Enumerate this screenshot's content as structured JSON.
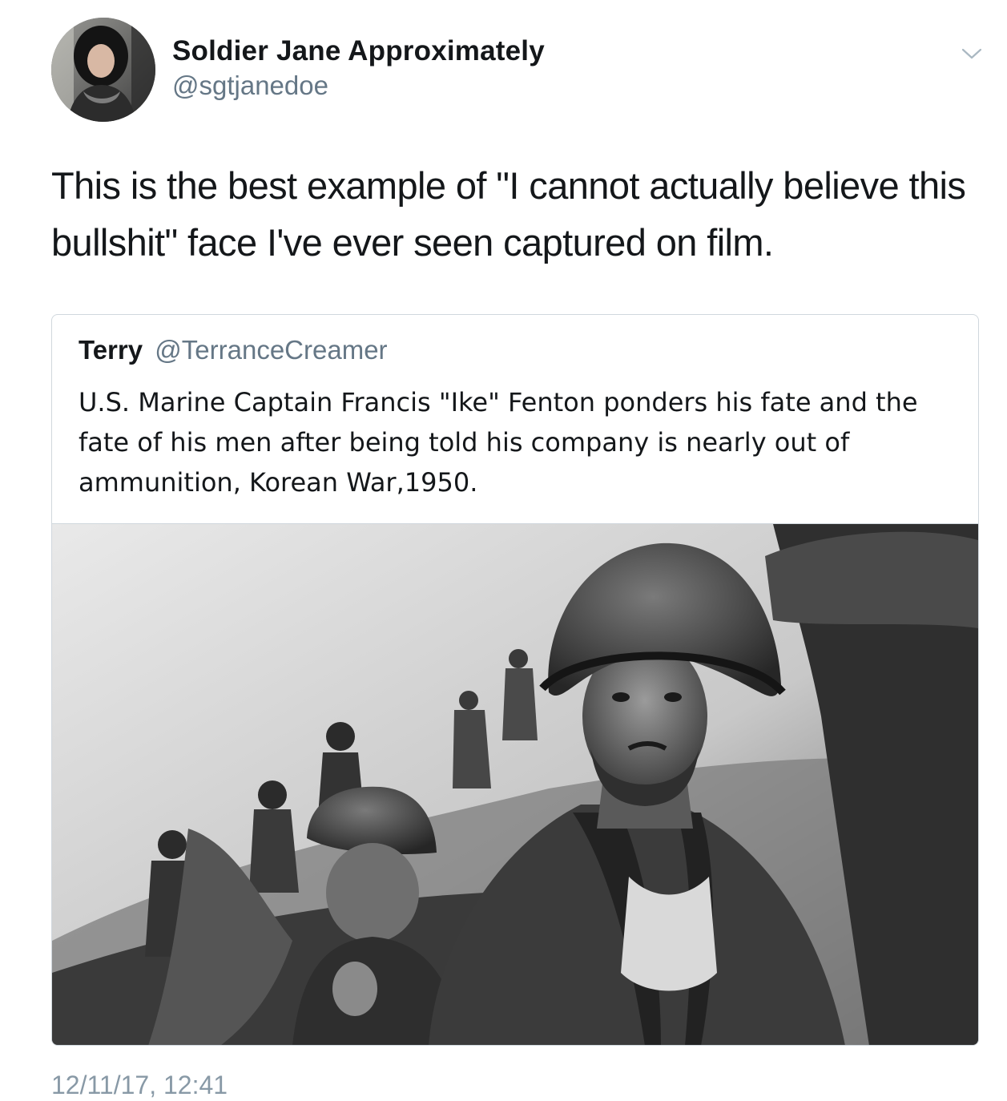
{
  "tweet": {
    "author": {
      "display_name": "Soldier Jane Approximately",
      "handle": "@sgtjanedoe"
    },
    "text": "This is the best example of \"I cannot actually believe this bullshit\" face I've ever seen captured on film.",
    "menu_icon": "chevron-down-icon",
    "quoted": {
      "display_name": "Terry",
      "handle": "@TerranceCreamer",
      "text": "U.S. Marine Captain Francis \"Ike\" Fenton ponders his fate and the fate of his men after being told his company is nearly out of ammunition, Korean War,1950."
    },
    "timestamp": "12/11/17, 12:41"
  },
  "colors": {
    "text_primary": "#14171a",
    "text_secondary": "#657786",
    "border": "#d0d7dd"
  }
}
